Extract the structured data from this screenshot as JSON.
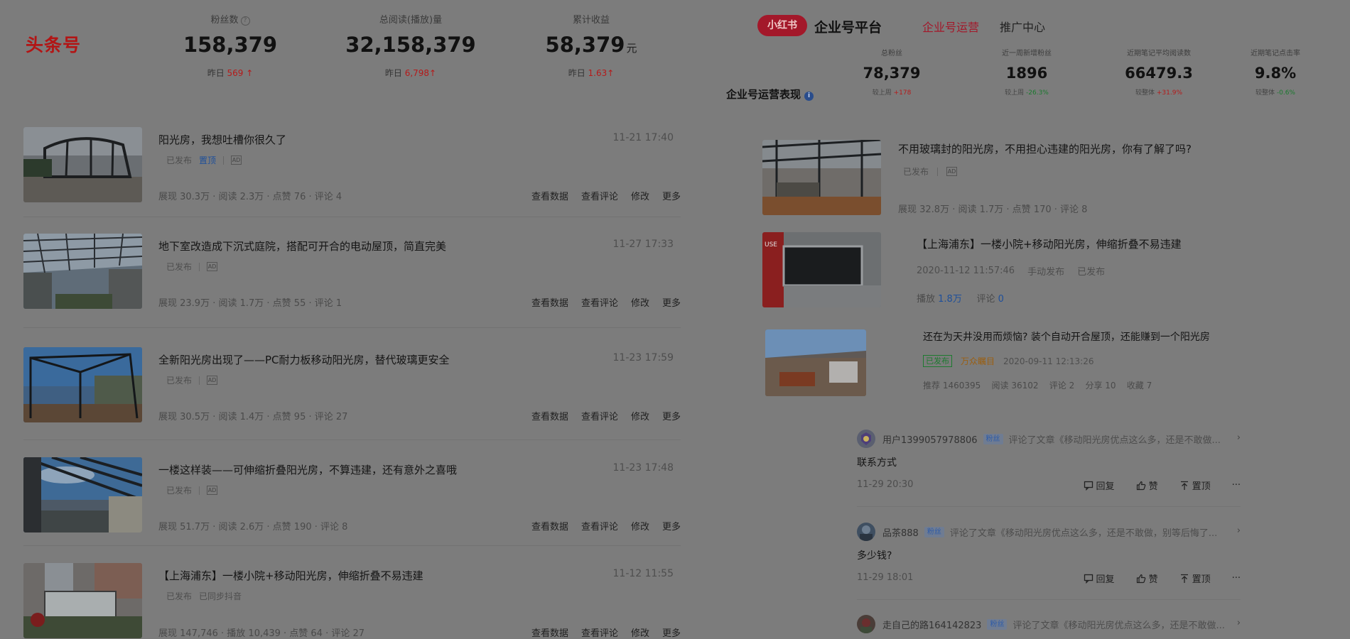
{
  "left": {
    "logo": "头条号",
    "stats": [
      {
        "label": "粉丝数",
        "value": "158,379",
        "unit": "",
        "sub_label": "昨日",
        "sub_value": "569 ↑"
      },
      {
        "label": "总阅读(播放)量",
        "value": "32,158,379",
        "unit": "",
        "sub_label": "昨日",
        "sub_value": "6,798↑"
      },
      {
        "label": "累计收益",
        "value": "58,379",
        "unit": "元",
        "sub_label": "昨日",
        "sub_value": "1.63↑"
      }
    ],
    "articles": [
      {
        "title": "阳光房，我想吐槽你很久了",
        "time": "11-21 17:40",
        "status": "已发布",
        "extra": "置顶",
        "ad": "AD",
        "metrics": "展现 30.3万 · 阅读 2.3万 · 点赞 76 · 评论 4"
      },
      {
        "title": "地下室改造成下沉式庭院，搭配可开合的电动屋顶，简直完美",
        "time": "11-27 17:33",
        "status": "已发布",
        "extra": "",
        "ad": "AD",
        "metrics": "展现 23.9万 · 阅读 1.7万 · 点赞 55 · 评论 1"
      },
      {
        "title": "全新阳光房出现了——PC耐力板移动阳光房，替代玻璃更安全",
        "time": "11-23 17:59",
        "status": "已发布",
        "extra": "",
        "ad": "AD",
        "metrics": "展现 30.5万 · 阅读 1.4万 · 点赞 95 · 评论 27"
      },
      {
        "title": "一楼这样装——可伸缩折叠阳光房，不算违建，还有意外之喜哦",
        "time": "11-23 17:48",
        "status": "已发布",
        "extra": "",
        "ad": "AD",
        "metrics": "展现 51.7万 · 阅读 2.6万 · 点赞 190 · 评论 8"
      },
      {
        "title": "【上海浦东】一楼小院+移动阳光房，伸缩折叠不易违建",
        "time": "11-12 11:55",
        "status": "已发布",
        "extra": "已同步抖音",
        "ad": "",
        "metrics": "展现 147,746 · 播放 10,439 · 点赞 64 · 评论 27"
      }
    ],
    "actions": [
      "查看数据",
      "查看评论",
      "修改",
      "更多"
    ]
  },
  "right": {
    "badge": "小红书",
    "title": "企业号平台",
    "tab_active": "企业号运营",
    "tab_other": "推广中心",
    "perf_label": "企业号运营表现",
    "stats": [
      {
        "label": "总粉丝",
        "value": "78,379",
        "sub_label": "较上周",
        "sub_value": "+178",
        "trend": "up"
      },
      {
        "label": "近一周新增粉丝",
        "value": "1896",
        "sub_label": "较上周",
        "sub_value": "-26.3%",
        "trend": "down"
      },
      {
        "label": "近期笔记平均阅读数",
        "value": "66479.3",
        "sub_label": "较整体",
        "sub_value": "+31.9%",
        "trend": "up"
      },
      {
        "label": "近期笔记点击率",
        "value": "9.8%",
        "sub_label": "较整体",
        "sub_value": "-0.6%",
        "trend": "down"
      }
    ],
    "notes": [
      {
        "title": "不用玻璃封的阳光房，不用担心违建的阳光房，你有了解了吗?",
        "status": "已发布",
        "ad": "AD",
        "metrics": "展现 32.8万 · 阅读 1.7万 · 点赞 170 · 评论 8"
      },
      {
        "title": "【上海浦东】一楼小院+移动阳光房，伸缩折叠不易违建",
        "date": "2020-11-12 11:57:46",
        "mode": "手动发布",
        "status": "已发布",
        "play_label": "播放",
        "play_value": "1.8万",
        "comment_label": "评论",
        "comment_value": "0"
      },
      {
        "title": "还在为天井没用而烦恼? 装个自动开合屋顶，还能赚到一个阳光房",
        "tag": "已发布",
        "tag2": "万众瞩目",
        "date": "2020-09-11 12:13:26",
        "metrics": "推荐 1460395    阅读 36102    评论 2    分享 10    收藏 7"
      }
    ],
    "comments": [
      {
        "user": "用户1399057978806",
        "fan": "粉丝",
        "action": "评论了文章《移动阳光房优点这么多，还是不敢做...",
        "body": "联系方式",
        "time": "11-29 20:30"
      },
      {
        "user": "品茶888",
        "fan": "粉丝",
        "action": "评论了文章《移动阳光房优点这么多，还是不敢做，别等后悔了...",
        "body": "多少钱?",
        "time": "11-29 18:01"
      },
      {
        "user": "走自己的路164142823",
        "fan": "粉丝",
        "action": "评论了文章《移动阳光房优点这么多，还是不敢做...",
        "body": "",
        "time": ""
      }
    ],
    "comment_actions": {
      "reply": "回复",
      "like": "赞",
      "pin": "置顶",
      "more": "···"
    },
    "chevron": "›"
  }
}
